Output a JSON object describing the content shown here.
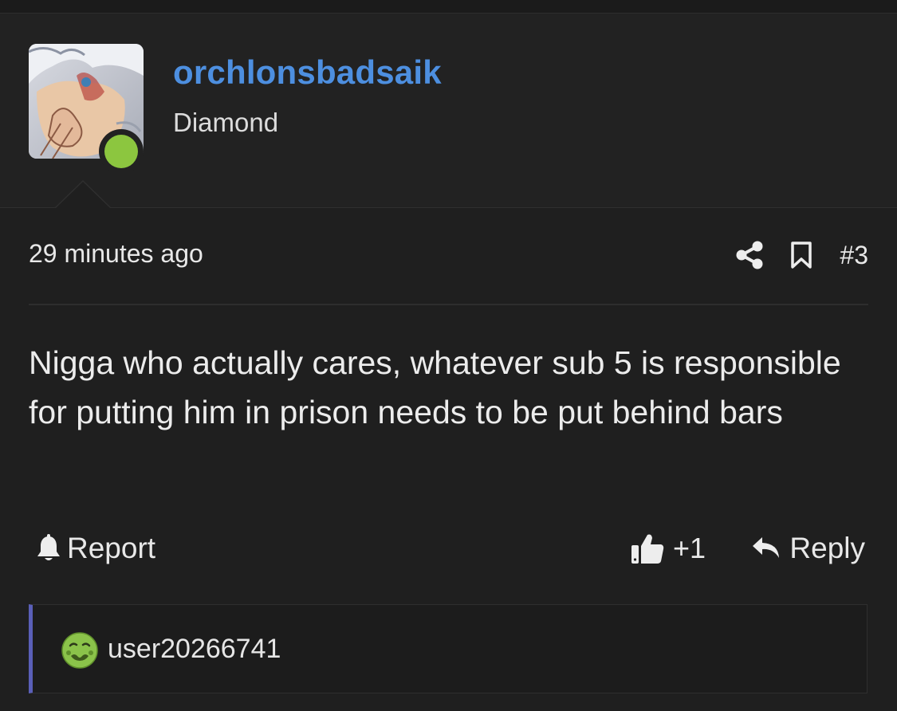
{
  "author": {
    "username": "orchlonsbadsaik",
    "rank": "Diamond",
    "online": true
  },
  "post": {
    "timestamp": "29 minutes ago",
    "number": "#3",
    "message": "Nigga who actually cares, whatever sub 5 is responsible for putting him in prison needs to be put behind bars"
  },
  "actions": {
    "report_label": "Report",
    "like_count": "+1",
    "reply_label": "Reply"
  },
  "reactions": {
    "user": "user20266741"
  },
  "colors": {
    "username": "#4d8fe0",
    "online": "#8cc63f",
    "reaction_bar": "#5a5fb8"
  },
  "icons": [
    "share-icon",
    "bookmark-icon",
    "bell-icon",
    "thumbs-up-icon",
    "reply-arrow-icon",
    "nauseated-face-emoji"
  ]
}
